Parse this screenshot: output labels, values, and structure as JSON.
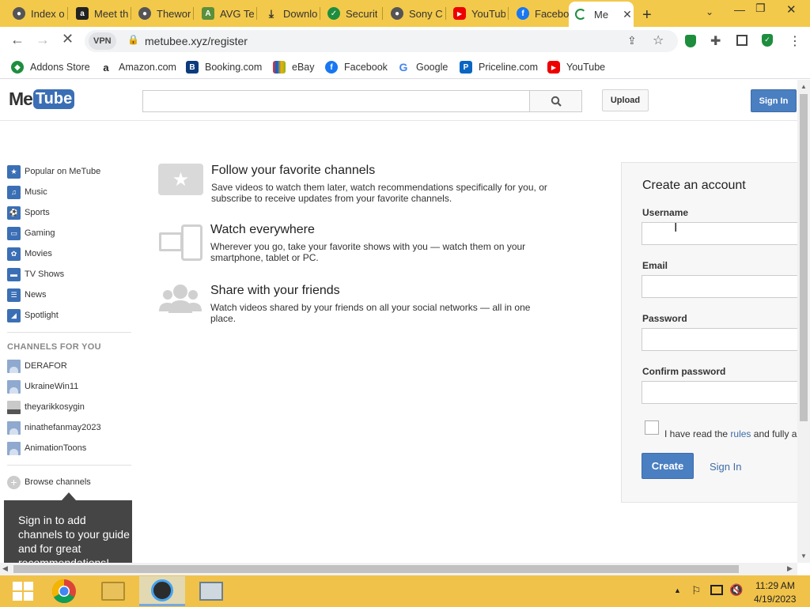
{
  "browser": {
    "tabs": [
      {
        "label": "Index o",
        "icon": "globe-icon"
      },
      {
        "label": "Meet th",
        "icon": "amazon-icon"
      },
      {
        "label": "Thewor",
        "icon": "globe-icon"
      },
      {
        "label": "AVG Te",
        "icon": "avg-icon"
      },
      {
        "label": "Downlo",
        "icon": "download-icon"
      },
      {
        "label": "Securit",
        "icon": "shield-icon"
      },
      {
        "label": "Sony C",
        "icon": "globe-icon"
      },
      {
        "label": "YouTub",
        "icon": "youtube-icon"
      },
      {
        "label": "Facebo",
        "icon": "facebook-icon"
      }
    ],
    "active_tab": {
      "label": "Me",
      "icon": "loading-icon"
    },
    "address": {
      "vpn": "VPN",
      "url": "metubee.xyz/register"
    },
    "bookmarks": [
      {
        "label": "Addons Store",
        "icon": "addons-icon"
      },
      {
        "label": "Amazon.com",
        "icon": "amazon-icon"
      },
      {
        "label": "Booking.com",
        "icon": "booking-icon"
      },
      {
        "label": "eBay",
        "icon": "ebay-icon"
      },
      {
        "label": "Facebook",
        "icon": "facebook-icon"
      },
      {
        "label": "Google",
        "icon": "google-icon"
      },
      {
        "label": "Priceline.com",
        "icon": "priceline-icon"
      },
      {
        "label": "YouTube",
        "icon": "youtube-icon"
      }
    ]
  },
  "site": {
    "logo": {
      "part1": "Me",
      "part2": "Tube"
    },
    "upload_label": "Upload",
    "signin_label": "Sign In",
    "guide": {
      "items": [
        {
          "label": "Popular on MeTube",
          "icon": "star-icon"
        },
        {
          "label": "Music",
          "icon": "headphones-icon"
        },
        {
          "label": "Sports",
          "icon": "ball-icon"
        },
        {
          "label": "Gaming",
          "icon": "gamepad-icon"
        },
        {
          "label": "Movies",
          "icon": "film-icon"
        },
        {
          "label": "TV Shows",
          "icon": "tv-icon"
        },
        {
          "label": "News",
          "icon": "news-icon"
        },
        {
          "label": "Spotlight",
          "icon": "spotlight-icon"
        }
      ],
      "channels_heading": "CHANNELS FOR YOU",
      "channels": [
        "DERAFOR",
        "UkraineWin11",
        "theyarikkosygin",
        "ninathefanmay2023",
        "AnimationToons"
      ],
      "browse_label": "Browse channels",
      "tooltip": "Sign in to add channels to your guide and for great recommendations!"
    },
    "features": [
      {
        "title": "Follow your favorite channels",
        "desc1": "Save videos to watch them later, watch recommendations specifically for you, or",
        "desc2": "subscribe to receive updates from your favorite channels."
      },
      {
        "title": "Watch everywhere",
        "desc1": "Wherever you go, take your favorite shows with you — watch them on your",
        "desc2": "smartphone, tablet or PC."
      },
      {
        "title": "Share with your friends",
        "desc1": "Watch videos shared by your friends on all your social networks — all in one",
        "desc2": "place."
      }
    ],
    "signup": {
      "title": "Create an account",
      "username_label": "Username",
      "email_label": "Email",
      "password_label": "Password",
      "confirm_label": "Confirm password",
      "agree_prefix": "I have read the",
      "agree_link": "rules",
      "agree_suffix": "and fully a",
      "create_label": "Create",
      "signin_link": "Sign In"
    }
  },
  "taskbar": {
    "time": "11:29 AM",
    "date": "4/19/2023"
  },
  "colors": {
    "accent_yellow": "#f3c94b",
    "metube_blue": "#4a7fc1",
    "link_blue": "#3d6ca8"
  }
}
